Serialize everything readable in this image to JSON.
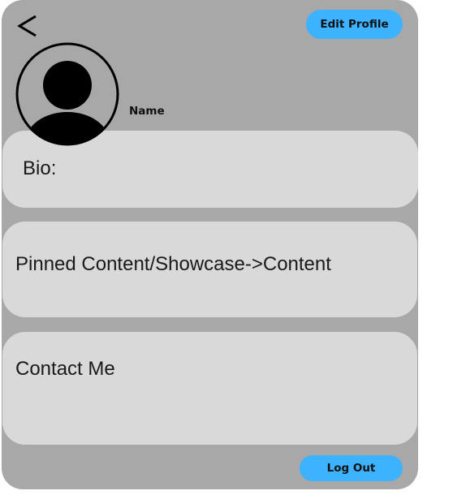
{
  "header": {
    "back_icon": "chevron-left-icon",
    "edit_profile_label": "Edit Profile"
  },
  "profile": {
    "avatar_icon": "user-avatar-icon",
    "name": "Name"
  },
  "sections": {
    "bio_label": "Bio:",
    "pinned_label": "Pinned Content/Showcase->Content",
    "contact_label": "Contact Me"
  },
  "footer": {
    "logout_label": "Log Out"
  },
  "colors": {
    "panel_bg": "#a8a8a8",
    "card_bg": "#d9d9d9",
    "button_accent": "#3db2ff"
  }
}
